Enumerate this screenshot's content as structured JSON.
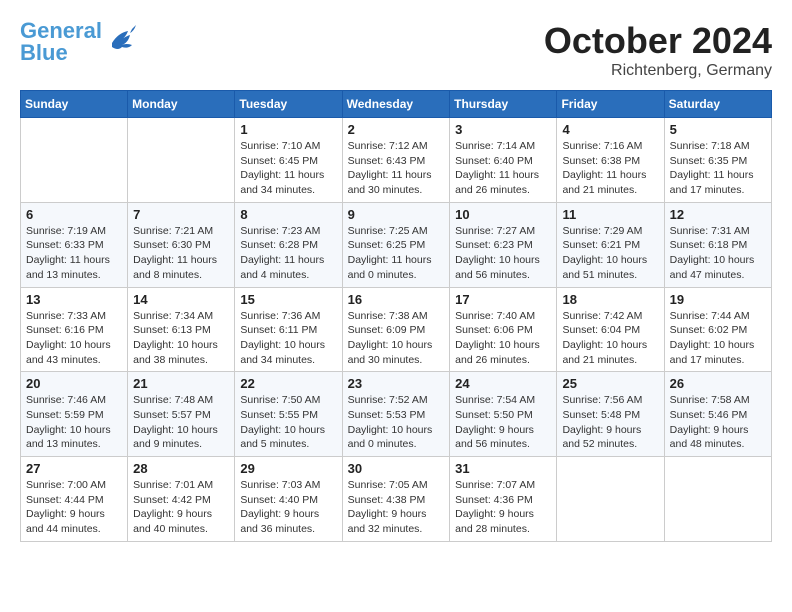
{
  "header": {
    "logo_line1": "General",
    "logo_line2": "Blue",
    "month_title": "October 2024",
    "location": "Richtenberg, Germany"
  },
  "days_of_week": [
    "Sunday",
    "Monday",
    "Tuesday",
    "Wednesday",
    "Thursday",
    "Friday",
    "Saturday"
  ],
  "weeks": [
    [
      {
        "day": "",
        "info": ""
      },
      {
        "day": "",
        "info": ""
      },
      {
        "day": "1",
        "info": "Sunrise: 7:10 AM\nSunset: 6:45 PM\nDaylight: 11 hours and 34 minutes."
      },
      {
        "day": "2",
        "info": "Sunrise: 7:12 AM\nSunset: 6:43 PM\nDaylight: 11 hours and 30 minutes."
      },
      {
        "day": "3",
        "info": "Sunrise: 7:14 AM\nSunset: 6:40 PM\nDaylight: 11 hours and 26 minutes."
      },
      {
        "day": "4",
        "info": "Sunrise: 7:16 AM\nSunset: 6:38 PM\nDaylight: 11 hours and 21 minutes."
      },
      {
        "day": "5",
        "info": "Sunrise: 7:18 AM\nSunset: 6:35 PM\nDaylight: 11 hours and 17 minutes."
      }
    ],
    [
      {
        "day": "6",
        "info": "Sunrise: 7:19 AM\nSunset: 6:33 PM\nDaylight: 11 hours and 13 minutes."
      },
      {
        "day": "7",
        "info": "Sunrise: 7:21 AM\nSunset: 6:30 PM\nDaylight: 11 hours and 8 minutes."
      },
      {
        "day": "8",
        "info": "Sunrise: 7:23 AM\nSunset: 6:28 PM\nDaylight: 11 hours and 4 minutes."
      },
      {
        "day": "9",
        "info": "Sunrise: 7:25 AM\nSunset: 6:25 PM\nDaylight: 11 hours and 0 minutes."
      },
      {
        "day": "10",
        "info": "Sunrise: 7:27 AM\nSunset: 6:23 PM\nDaylight: 10 hours and 56 minutes."
      },
      {
        "day": "11",
        "info": "Sunrise: 7:29 AM\nSunset: 6:21 PM\nDaylight: 10 hours and 51 minutes."
      },
      {
        "day": "12",
        "info": "Sunrise: 7:31 AM\nSunset: 6:18 PM\nDaylight: 10 hours and 47 minutes."
      }
    ],
    [
      {
        "day": "13",
        "info": "Sunrise: 7:33 AM\nSunset: 6:16 PM\nDaylight: 10 hours and 43 minutes."
      },
      {
        "day": "14",
        "info": "Sunrise: 7:34 AM\nSunset: 6:13 PM\nDaylight: 10 hours and 38 minutes."
      },
      {
        "day": "15",
        "info": "Sunrise: 7:36 AM\nSunset: 6:11 PM\nDaylight: 10 hours and 34 minutes."
      },
      {
        "day": "16",
        "info": "Sunrise: 7:38 AM\nSunset: 6:09 PM\nDaylight: 10 hours and 30 minutes."
      },
      {
        "day": "17",
        "info": "Sunrise: 7:40 AM\nSunset: 6:06 PM\nDaylight: 10 hours and 26 minutes."
      },
      {
        "day": "18",
        "info": "Sunrise: 7:42 AM\nSunset: 6:04 PM\nDaylight: 10 hours and 21 minutes."
      },
      {
        "day": "19",
        "info": "Sunrise: 7:44 AM\nSunset: 6:02 PM\nDaylight: 10 hours and 17 minutes."
      }
    ],
    [
      {
        "day": "20",
        "info": "Sunrise: 7:46 AM\nSunset: 5:59 PM\nDaylight: 10 hours and 13 minutes."
      },
      {
        "day": "21",
        "info": "Sunrise: 7:48 AM\nSunset: 5:57 PM\nDaylight: 10 hours and 9 minutes."
      },
      {
        "day": "22",
        "info": "Sunrise: 7:50 AM\nSunset: 5:55 PM\nDaylight: 10 hours and 5 minutes."
      },
      {
        "day": "23",
        "info": "Sunrise: 7:52 AM\nSunset: 5:53 PM\nDaylight: 10 hours and 0 minutes."
      },
      {
        "day": "24",
        "info": "Sunrise: 7:54 AM\nSunset: 5:50 PM\nDaylight: 9 hours and 56 minutes."
      },
      {
        "day": "25",
        "info": "Sunrise: 7:56 AM\nSunset: 5:48 PM\nDaylight: 9 hours and 52 minutes."
      },
      {
        "day": "26",
        "info": "Sunrise: 7:58 AM\nSunset: 5:46 PM\nDaylight: 9 hours and 48 minutes."
      }
    ],
    [
      {
        "day": "27",
        "info": "Sunrise: 7:00 AM\nSunset: 4:44 PM\nDaylight: 9 hours and 44 minutes."
      },
      {
        "day": "28",
        "info": "Sunrise: 7:01 AM\nSunset: 4:42 PM\nDaylight: 9 hours and 40 minutes."
      },
      {
        "day": "29",
        "info": "Sunrise: 7:03 AM\nSunset: 4:40 PM\nDaylight: 9 hours and 36 minutes."
      },
      {
        "day": "30",
        "info": "Sunrise: 7:05 AM\nSunset: 4:38 PM\nDaylight: 9 hours and 32 minutes."
      },
      {
        "day": "31",
        "info": "Sunrise: 7:07 AM\nSunset: 4:36 PM\nDaylight: 9 hours and 28 minutes."
      },
      {
        "day": "",
        "info": ""
      },
      {
        "day": "",
        "info": ""
      }
    ]
  ]
}
